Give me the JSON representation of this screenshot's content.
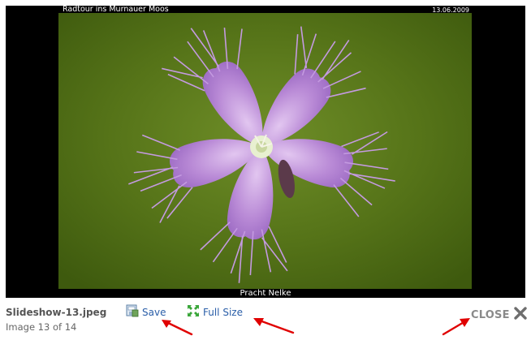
{
  "slide": {
    "caption_top_left": "Radtour ins Murnauer Moos",
    "caption_top_right": "13.06.2009",
    "caption_bottom": "Pracht Nelke"
  },
  "info": {
    "filename": "Slideshow-13.jpeg",
    "counter": "Image 13 of 14"
  },
  "actions": {
    "save_label": "Save",
    "save_icon": "save-icon",
    "fullsize_label": "Full Size",
    "fullsize_icon": "fullscreen-icon"
  },
  "close": {
    "label": "CLOSE",
    "icon": "close-icon"
  },
  "colors": {
    "link": "#2a5ea8",
    "arrow": "#e00000",
    "frame": "#000000",
    "photo_background": "#5a7a1a",
    "petal": "#b98ad6"
  }
}
